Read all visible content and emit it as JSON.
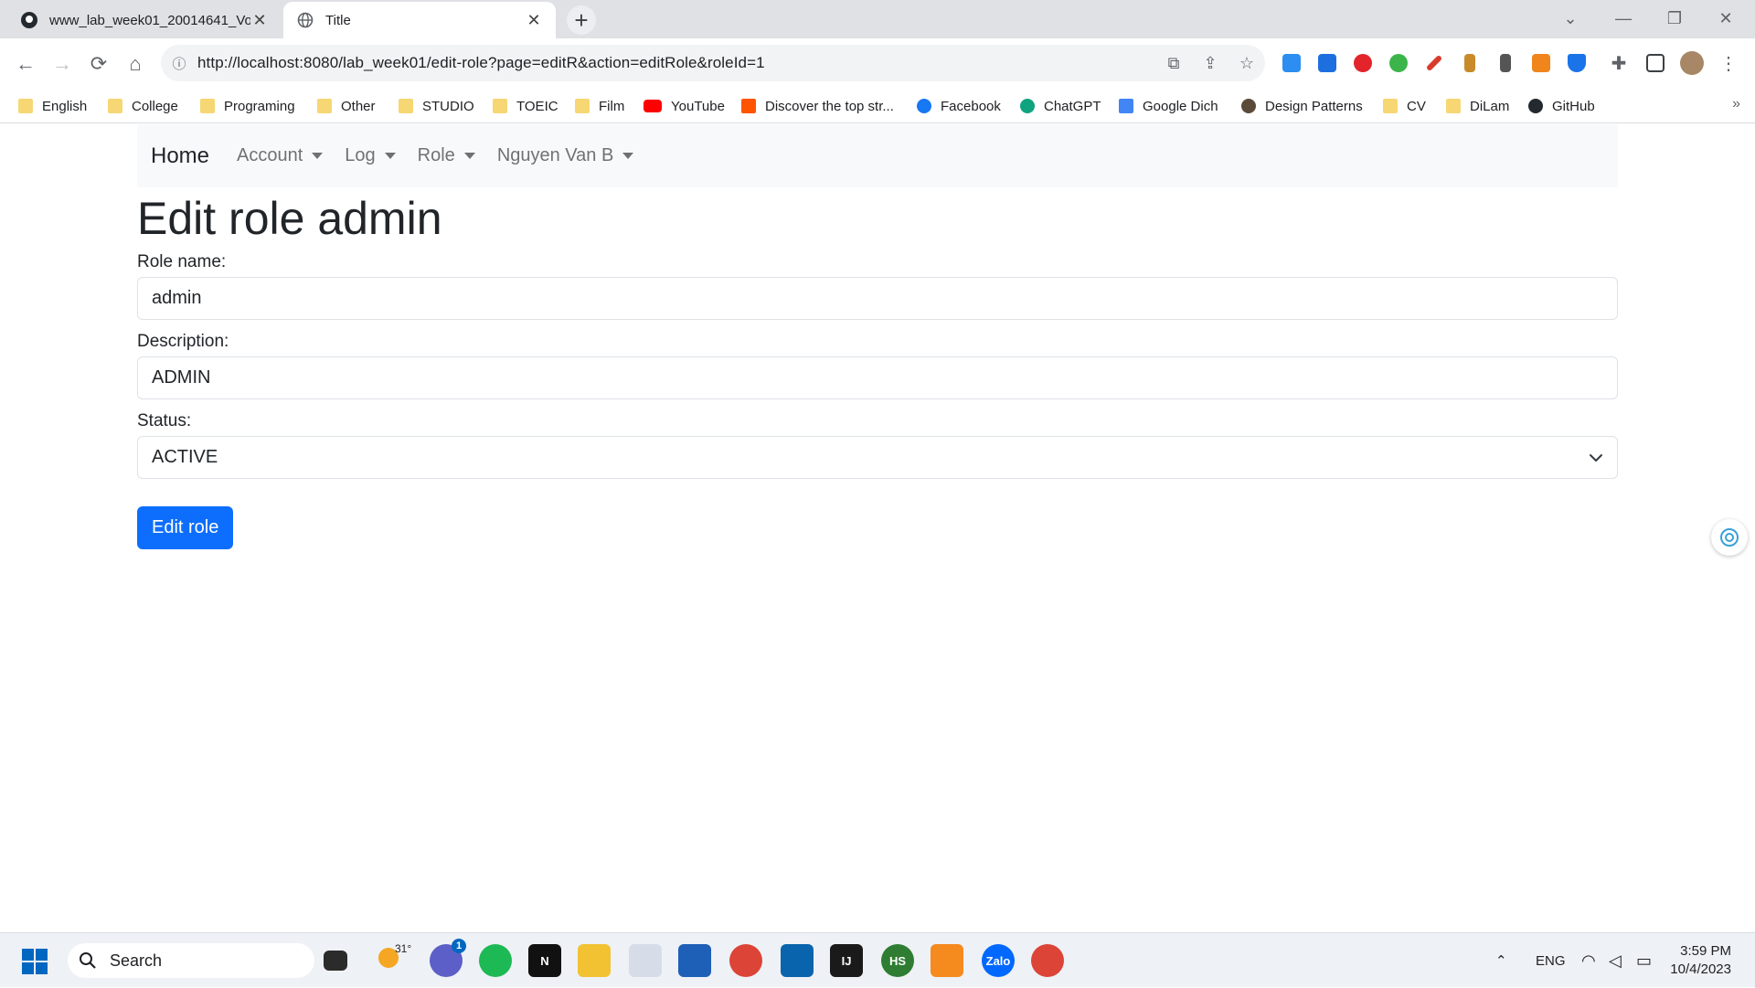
{
  "browser": {
    "tabs": [
      {
        "title": "www_lab_week01_20014641_Vo",
        "active": false
      },
      {
        "title": "Title",
        "active": true
      }
    ],
    "url": "http://localhost:8080/lab_week01/edit-role?page=editR&action=editRole&roleId=1",
    "bookmarks": [
      "English",
      "College",
      "Programing",
      "Other",
      "STUDIO",
      "TOEIC",
      "Film",
      "YouTube",
      "Discover the top str...",
      "Facebook",
      "ChatGPT",
      "Google Dich",
      "Design Patterns",
      "CV",
      "DiLam",
      "GitHub"
    ],
    "bookmarks_more": "»"
  },
  "nav": {
    "brand": "Home",
    "items": [
      "Account",
      "Log",
      "Role",
      "Nguyen Van B"
    ]
  },
  "form": {
    "heading": "Edit role admin",
    "role_name_label": "Role name:",
    "role_name_value": "admin",
    "description_label": "Description:",
    "description_value": "ADMIN",
    "status_label": "Status:",
    "status_value": "ACTIVE",
    "submit_label": "Edit role"
  },
  "taskbar": {
    "search_label": "Search",
    "weather": "31°",
    "chat_badge": "1",
    "language": "ENG",
    "time": "3:59 PM",
    "date": "10/4/2023"
  },
  "colors": {
    "primary": "#0d6efd",
    "navbar_bg": "#f8f9fa",
    "chrome_tabbar": "#dfe1e5"
  }
}
